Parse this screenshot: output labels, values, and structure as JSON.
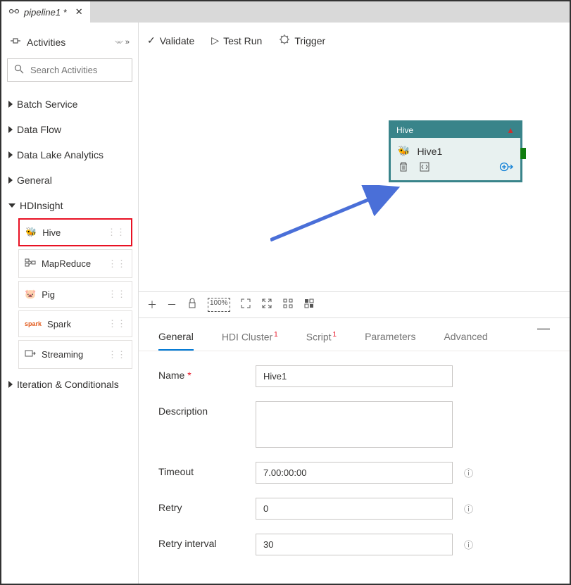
{
  "tab": {
    "label": "pipeline1 *"
  },
  "activities": {
    "title": "Activities",
    "search_placeholder": "Search Activities",
    "groups": [
      {
        "label": "Batch Service",
        "expanded": false
      },
      {
        "label": "Data Flow",
        "expanded": false
      },
      {
        "label": "Data Lake Analytics",
        "expanded": false
      },
      {
        "label": "General",
        "expanded": false
      },
      {
        "label": "HDInsight",
        "expanded": true
      },
      {
        "label": "Iteration & Conditionals",
        "expanded": false
      }
    ],
    "hdinsight_items": [
      {
        "label": "Hive",
        "selected": true
      },
      {
        "label": "MapReduce",
        "selected": false
      },
      {
        "label": "Pig",
        "selected": false
      },
      {
        "label": "Spark",
        "selected": false
      },
      {
        "label": "Streaming",
        "selected": false
      }
    ]
  },
  "canvas_toolbar": {
    "validate": "Validate",
    "test_run": "Test Run",
    "trigger": "Trigger"
  },
  "node": {
    "type_label": "Hive",
    "title": "Hive1"
  },
  "details": {
    "tabs": {
      "general": "General",
      "hdi": "HDI Cluster",
      "script": "Script",
      "parameters": "Parameters",
      "advanced": "Advanced"
    },
    "fields": {
      "name_label": "Name",
      "name_value": "Hive1",
      "description_label": "Description",
      "description_value": "",
      "timeout_label": "Timeout",
      "timeout_value": "7.00:00:00",
      "retry_label": "Retry",
      "retry_value": "0",
      "retry_interval_label": "Retry interval",
      "retry_interval_value": "30"
    }
  }
}
